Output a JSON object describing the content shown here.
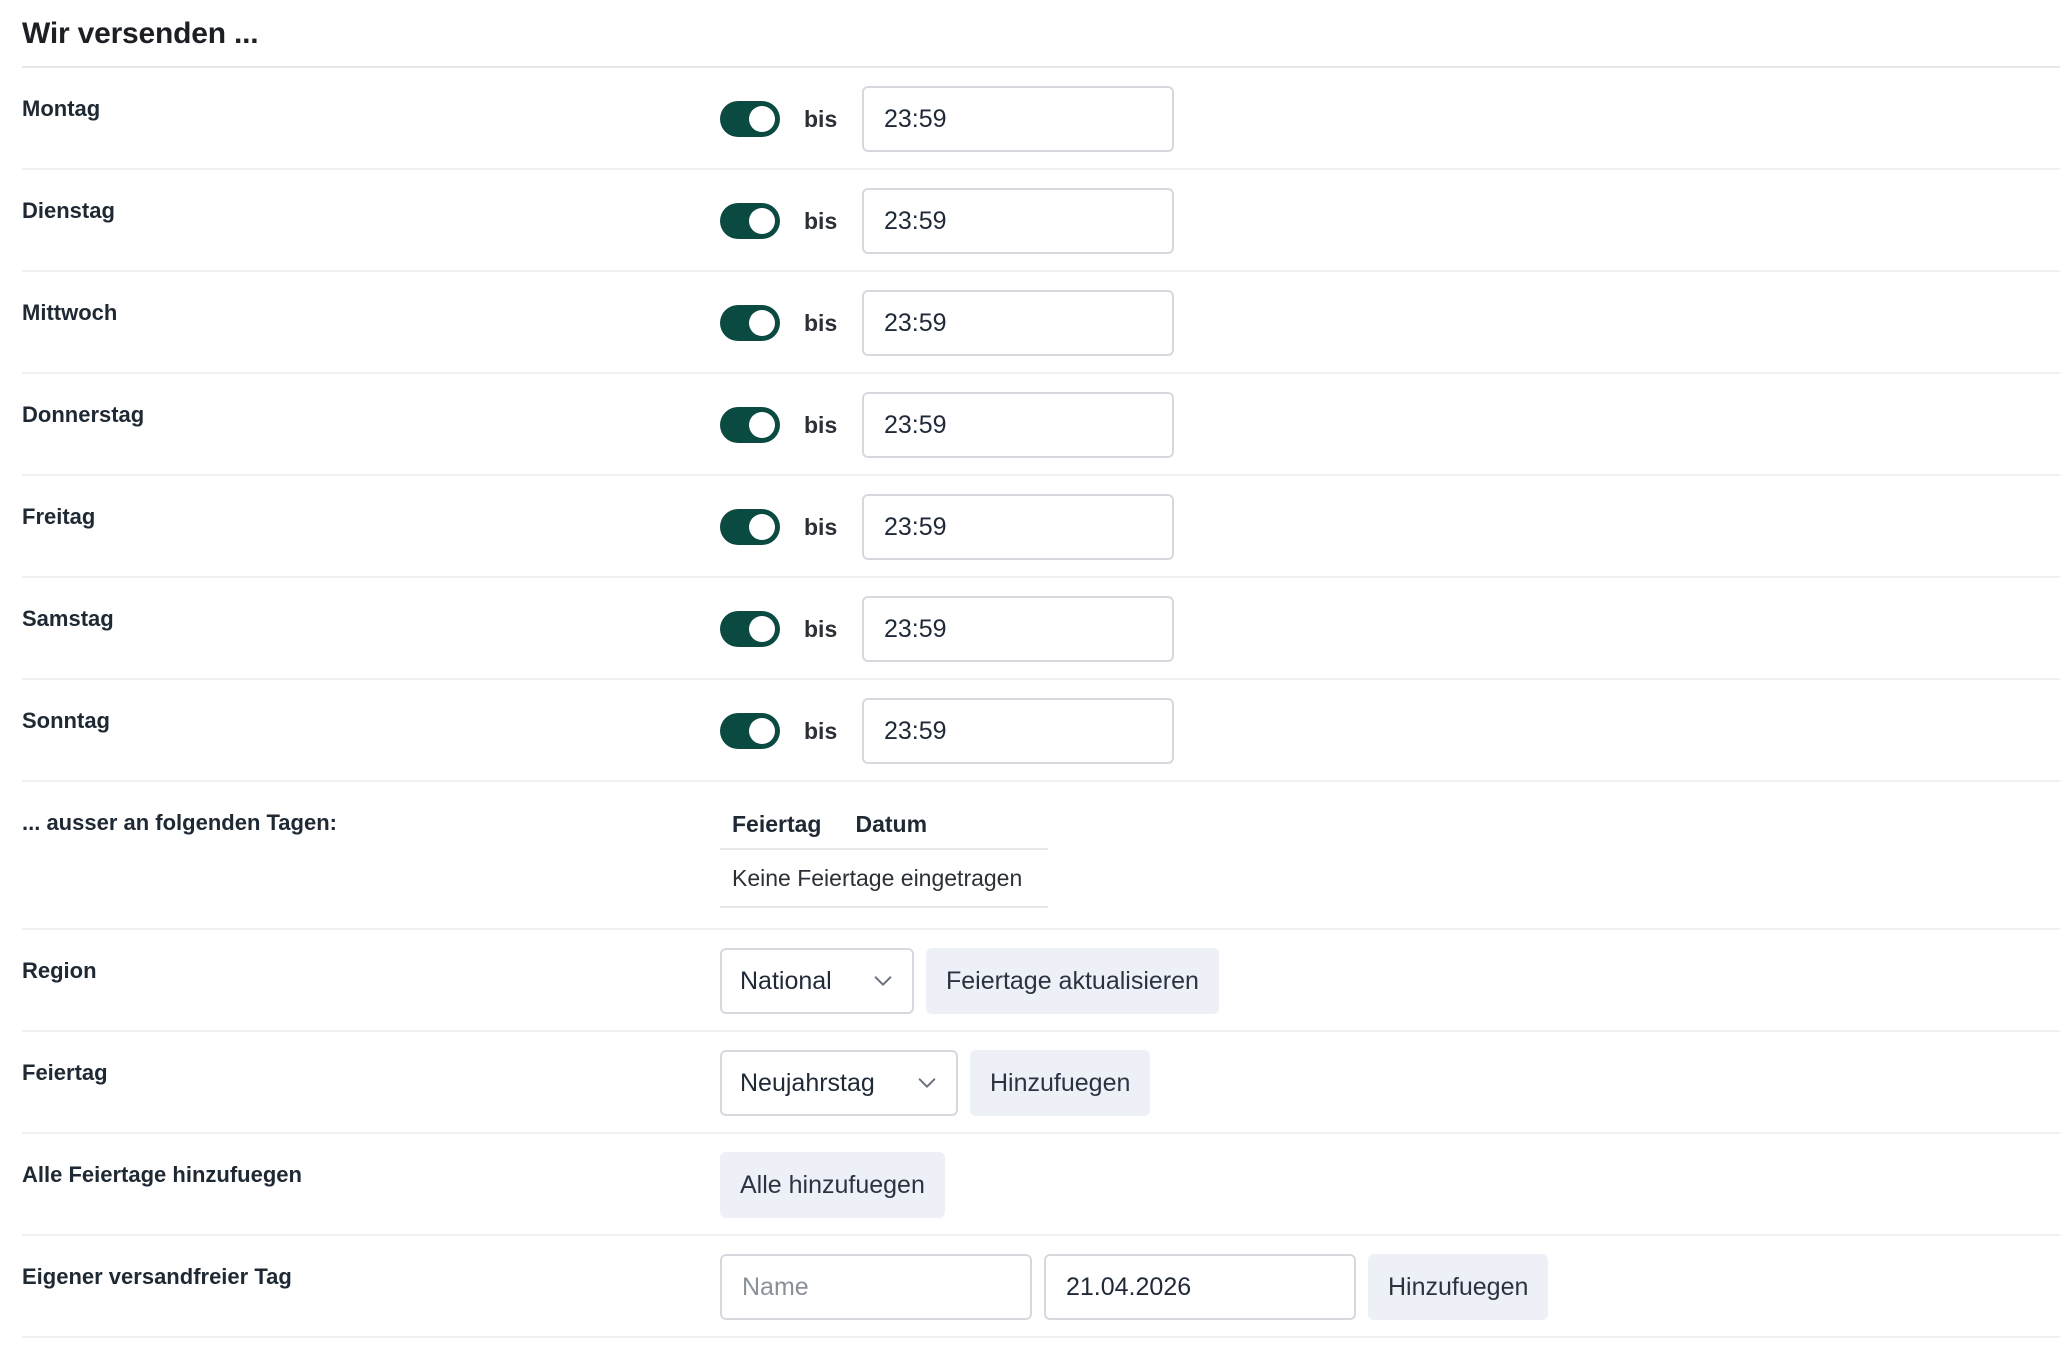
{
  "section": {
    "title": "Wir versenden ..."
  },
  "days": [
    {
      "label": "Montag",
      "enabled": true,
      "bis": "bis",
      "time": "23:59"
    },
    {
      "label": "Dienstag",
      "enabled": true,
      "bis": "bis",
      "time": "23:59"
    },
    {
      "label": "Mittwoch",
      "enabled": true,
      "bis": "bis",
      "time": "23:59"
    },
    {
      "label": "Donnerstag",
      "enabled": true,
      "bis": "bis",
      "time": "23:59"
    },
    {
      "label": "Freitag",
      "enabled": true,
      "bis": "bis",
      "time": "23:59"
    },
    {
      "label": "Samstag",
      "enabled": true,
      "bis": "bis",
      "time": "23:59"
    },
    {
      "label": "Sonntag",
      "enabled": true,
      "bis": "bis",
      "time": "23:59"
    }
  ],
  "exceptions": {
    "label": "... ausser an folgenden Tagen:",
    "columns": [
      "Feiertag",
      "Datum"
    ],
    "empty_text": "Keine Feiertage eingetragen"
  },
  "region": {
    "label": "Region",
    "selected": "National",
    "button": "Feiertage aktualisieren"
  },
  "holiday": {
    "label": "Feiertag",
    "selected": "Neujahrstag",
    "button": "Hinzufuegen"
  },
  "add_all": {
    "label": "Alle Feiertage hinzufuegen",
    "button": "Alle hinzufuegen"
  },
  "custom_day": {
    "label": "Eigener versandfreier Tag",
    "name_placeholder": "Name",
    "date_value": "21.04.2026",
    "button": "Hinzufuegen"
  },
  "colors": {
    "toggle_on": "#0b4a40",
    "button_bg": "#edf0f7",
    "border": "#d5d9de"
  },
  "icons": {
    "select_arrow": "chevron-down-icon"
  }
}
